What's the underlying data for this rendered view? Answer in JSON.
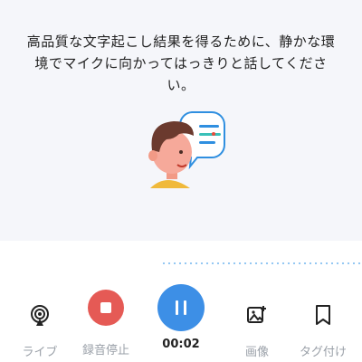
{
  "message": "高品質な文字起こし結果を得るために、静かな環境でマイクに向かってはっきりと話してください。",
  "toolbar": {
    "live_label": "ライブ",
    "stop_label": "録音停止",
    "timer": "00:02",
    "image_label": "画像",
    "tag_label": "タグ付け"
  },
  "colors": {
    "stop": "#e55a55",
    "pause": "#3d8fe6",
    "background": "#f5f6fa"
  },
  "icons": [
    "live-broadcast-icon",
    "stop-icon",
    "pause-icon",
    "add-image-icon",
    "bookmark-icon"
  ]
}
